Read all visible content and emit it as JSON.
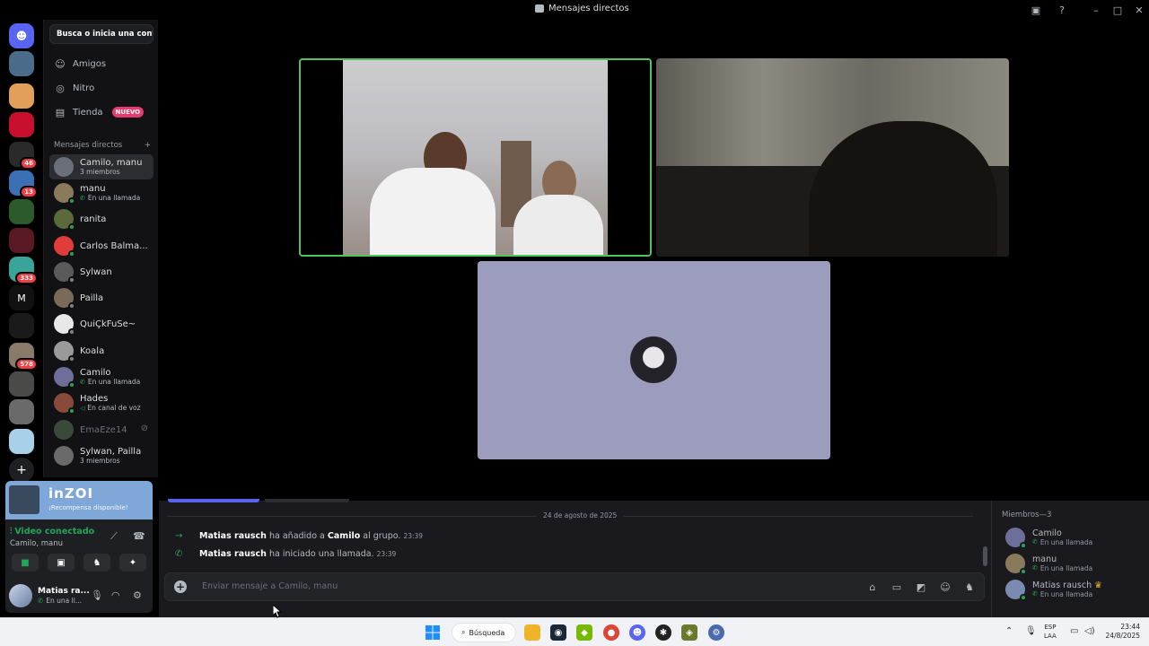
{
  "window": {
    "title": "Mensajes directos"
  },
  "servers": [
    {
      "name": "Discord",
      "badge": "",
      "color": "#5865f2"
    },
    {
      "name": "server-2",
      "badge": "",
      "color": "#4b6b8a"
    },
    {
      "name": "server-3",
      "badge": "",
      "color": "#e0a05a"
    },
    {
      "name": "server-4",
      "badge": "",
      "color": "#c8102e"
    },
    {
      "name": "server-5",
      "badge": "46",
      "color": "#2a2a2a"
    },
    {
      "name": "server-6",
      "badge": "13",
      "color": "#3d6fb5"
    },
    {
      "name": "server-7",
      "badge": "",
      "color": "#2d5a2d"
    },
    {
      "name": "server-8",
      "badge": "",
      "color": "#5a1a24"
    },
    {
      "name": "server-9",
      "badge": "333",
      "color": "#3aa39a"
    },
    {
      "name": "M",
      "badge": "",
      "color": "#111111"
    },
    {
      "name": "server-11",
      "badge": "",
      "color": "#1a1a1a"
    },
    {
      "name": "server-12",
      "badge": "578",
      "color": "#8a7a6a"
    },
    {
      "name": "server-13",
      "badge": "",
      "color": "#4a4a48"
    },
    {
      "name": "server-14",
      "badge": "",
      "color": "#6a6a6a"
    },
    {
      "name": "server-15",
      "badge": "",
      "color": "#a8d0e8"
    }
  ],
  "dm_sidebar": {
    "search_placeholder": "Busca o inicia una conv...",
    "nav": [
      {
        "label": "Amigos",
        "icon": "person-wave-icon"
      },
      {
        "label": "Nitro",
        "icon": "nitro-icon"
      },
      {
        "label": "Tienda",
        "icon": "shop-icon",
        "tag": "NUEVO"
      }
    ],
    "section_title": "Mensajes directos",
    "section_add": "+",
    "dms": [
      {
        "name": "Camilo, manu",
        "sub": "3 miembros",
        "status": "",
        "active": true,
        "color": "#6b6f7a"
      },
      {
        "name": "manu",
        "sub": "En una llamada",
        "status": "call",
        "color": "#8a7a5c"
      },
      {
        "name": "ranita",
        "sub": "",
        "status": "on",
        "color": "#5b6a3a"
      },
      {
        "name": "Carlos Balma...",
        "sub": "",
        "status": "on",
        "color": "#e03c3c"
      },
      {
        "name": "Sylwan",
        "sub": "",
        "status": "off",
        "color": "#5a5a5a"
      },
      {
        "name": "Pailla",
        "sub": "",
        "status": "off",
        "color": "#7a6a5a"
      },
      {
        "name": "QuiÇkFuSe~",
        "sub": "",
        "status": "off",
        "color": "#e8e8e8"
      },
      {
        "name": "Koala",
        "sub": "",
        "status": "off",
        "color": "#9a9a9a"
      },
      {
        "name": "Camilo",
        "sub": "En una llamada",
        "status": "call",
        "color": "#6e6e9a"
      },
      {
        "name": "Hades",
        "sub": "En canal de voz",
        "status": "voice",
        "color": "#8a4a3a"
      },
      {
        "name": "EmaEze14",
        "sub": "",
        "status": "dim",
        "color": "#3a4a3a"
      },
      {
        "name": "Sylwan, Pailla",
        "sub": "3 miembros",
        "status": "",
        "color": "#6a6a6a"
      }
    ]
  },
  "promo": {
    "title": "inZOI",
    "subtitle": "¡Recompensa disponible!"
  },
  "voice": {
    "status": "Video conectado",
    "channel": "Camilo, manu"
  },
  "user": {
    "name": "Matias ra...",
    "status": "En una ll..."
  },
  "chat": {
    "date": "24 de agosto de 2025",
    "messages": [
      {
        "icon": "→",
        "author": "Matias rausch",
        "text1": "ha añadido a",
        "target": "Camilo",
        "text2": "al grupo.",
        "time": "23:39"
      },
      {
        "icon": "✆",
        "author": "Matias rausch",
        "text1": "ha iniciado una llamada.",
        "target": "",
        "text2": "",
        "time": "23:39"
      }
    ],
    "composer_placeholder": "Enviar mensaje a Camilo, manu"
  },
  "members": {
    "header": "Miembros—3",
    "list": [
      {
        "name": "Camilo",
        "sub": "En una llamada",
        "color": "#6e6e9a",
        "crown": ""
      },
      {
        "name": "manu",
        "sub": "En una llamada",
        "color": "#8a7a5c",
        "crown": ""
      },
      {
        "name": "Matias rausch",
        "sub": "En una llamada",
        "color": "#7a8ab0",
        "crown": "♛"
      }
    ]
  },
  "taskbar": {
    "search": "Búsqueda",
    "lang1": "ESP",
    "lang2": "LAA",
    "time": "23:44",
    "date": "24/8/2025"
  }
}
